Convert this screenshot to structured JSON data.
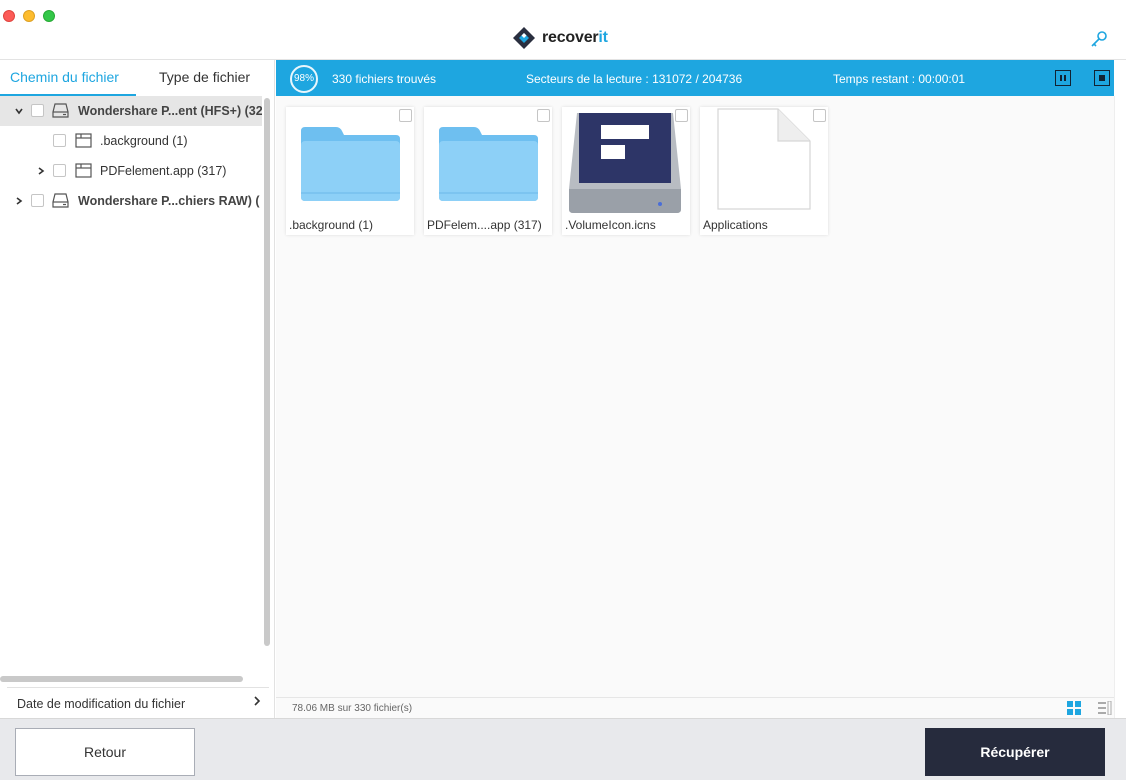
{
  "app": {
    "logo_text": "recover",
    "logo_text_accent": "it",
    "brand_color": "#1ea6e0"
  },
  "sidebar": {
    "tabs": [
      {
        "label": "Chemin du fichier",
        "active": true
      },
      {
        "label": "Type de fichier",
        "active": false
      }
    ],
    "tree": [
      {
        "label": "Wondershare P...ent (HFS+) (32",
        "bold": true,
        "expanded": true,
        "selected": true,
        "icon": "drive-icon"
      },
      {
        "label": ".background (1)",
        "bold": false,
        "icon": "folder-outline-icon"
      },
      {
        "label": "PDFelement.app (317)",
        "bold": false,
        "icon": "folder-outline-icon"
      },
      {
        "label": "Wondershare P...chiers RAW) (",
        "bold": true,
        "icon": "drive-icon"
      }
    ],
    "filter_label": "Date de modification du fichier"
  },
  "statusbar": {
    "progress": "98%",
    "found": "330 fichiers trouvés",
    "sectors": "Secteurs de la lecture : 131072 / 204736",
    "remaining": "Temps restant : 00:00:01"
  },
  "files": [
    {
      "name": ".background (1)",
      "icon": "folder-icon"
    },
    {
      "name": "PDFelem....app (317)",
      "icon": "folder-icon"
    },
    {
      "name": ".VolumeIcon.icns",
      "icon": "drive-image-icon"
    },
    {
      "name": "Applications",
      "icon": "document-icon"
    }
  ],
  "footer": {
    "size_info": "78.06 MB sur 330 fichier(s)"
  },
  "buttons": {
    "back": "Retour",
    "recover": "Récupérer"
  }
}
